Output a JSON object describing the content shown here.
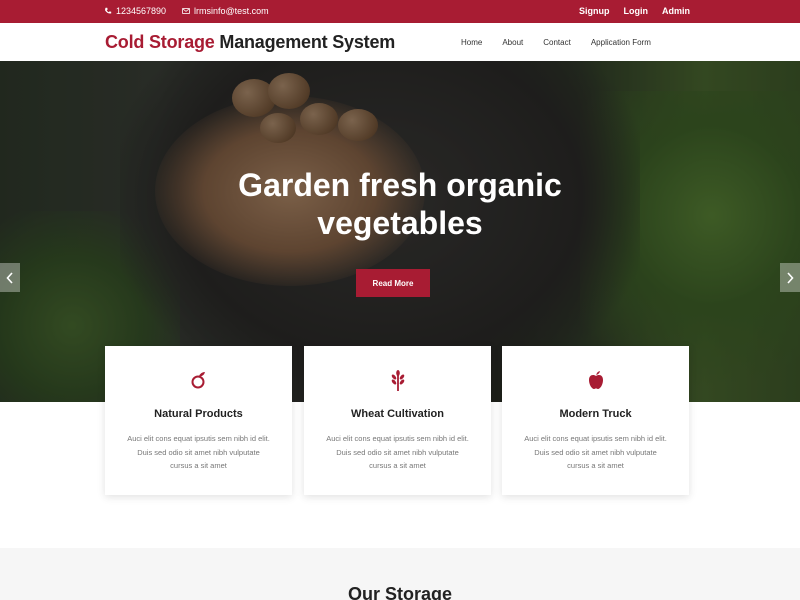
{
  "topbar": {
    "phone": "1234567890",
    "email": "lrmsinfo@test.com",
    "links": [
      "Signup",
      "Login",
      "Admin"
    ]
  },
  "header": {
    "brand_accent": "Cold Storage",
    "brand_rest": " Management System",
    "nav": [
      "Home",
      "About",
      "Contact",
      "Application Form"
    ]
  },
  "hero": {
    "title_line1": "Garden fresh organic",
    "title_line2": "vegetables",
    "button": "Read More"
  },
  "cards": [
    {
      "icon": "fruit-icon",
      "title": "Natural Products",
      "desc_line1": "Auci elit cons equat ipsutis sem nibh id elit.",
      "desc_line2": "Duis sed odio sit amet nibh vulputate",
      "desc_line3": "cursus a sit amet"
    },
    {
      "icon": "wheat-icon",
      "title": "Wheat Cultivation",
      "desc_line1": "Auci elit cons equat ipsutis sem nibh id elit.",
      "desc_line2": "Duis sed odio sit amet nibh vulputate",
      "desc_line3": "cursus a sit amet"
    },
    {
      "icon": "apple-icon",
      "title": "Modern Truck",
      "desc_line1": "Auci elit cons equat ipsutis sem nibh id elit.",
      "desc_line2": "Duis sed odio sit amet nibh vulputate",
      "desc_line3": "cursus a sit amet"
    }
  ],
  "section": {
    "heading": "Our Storage"
  },
  "colors": {
    "accent": "#a81c33"
  }
}
